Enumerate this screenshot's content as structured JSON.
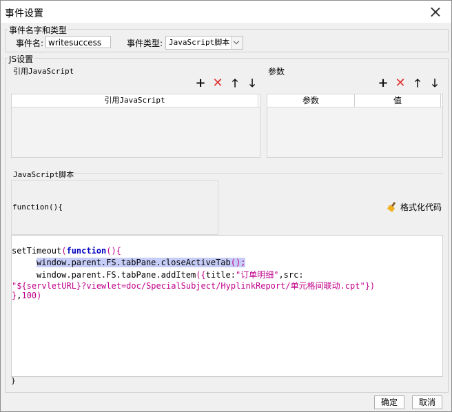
{
  "window": {
    "title": "事件设置"
  },
  "event_name_group": {
    "legend": "事件名字和类型",
    "name_label": "事件名:",
    "name_value": "writesuccess",
    "type_label": "事件类型:",
    "type_value": "JavaScript脚本"
  },
  "js_group": {
    "legend": "JS设置",
    "ref_section": {
      "title": "引用JavaScript",
      "column": "引用JavaScript"
    },
    "param_section": {
      "title": "参数",
      "columns": [
        "参数",
        "值"
      ]
    },
    "script_label": "JavaScript脚本",
    "function_header": "function(){",
    "format_button": "格式化代码",
    "code": {
      "l1_fn": "setTimeout",
      "l1_kw": "function",
      "l2": "window.parent.FS.tabPane.closeActiveTab",
      "l2_end": "();",
      "l3_pre": "window.parent.FS.tabPane.addItem",
      "l3_title_key": "title:",
      "l3_title_val": "\"订单明细\"",
      "l3_src": ",src:",
      "l4": "\"${servletURL}?viewlet=doc/SpecialSubject/HyplinkReport/单元格间联动.cpt\"",
      "l5_num": "100",
      "closing": "}"
    }
  },
  "toolbar_icons": [
    "plus-icon",
    "delete-icon",
    "arrow-up-icon",
    "arrow-down-icon"
  ],
  "buttons": {
    "ok": "确定",
    "cancel": "取消"
  },
  "colors": {
    "keyword": "#0000c0",
    "string": "#c0008a",
    "selection": "#c6cdf7",
    "delete": "#e03030"
  }
}
